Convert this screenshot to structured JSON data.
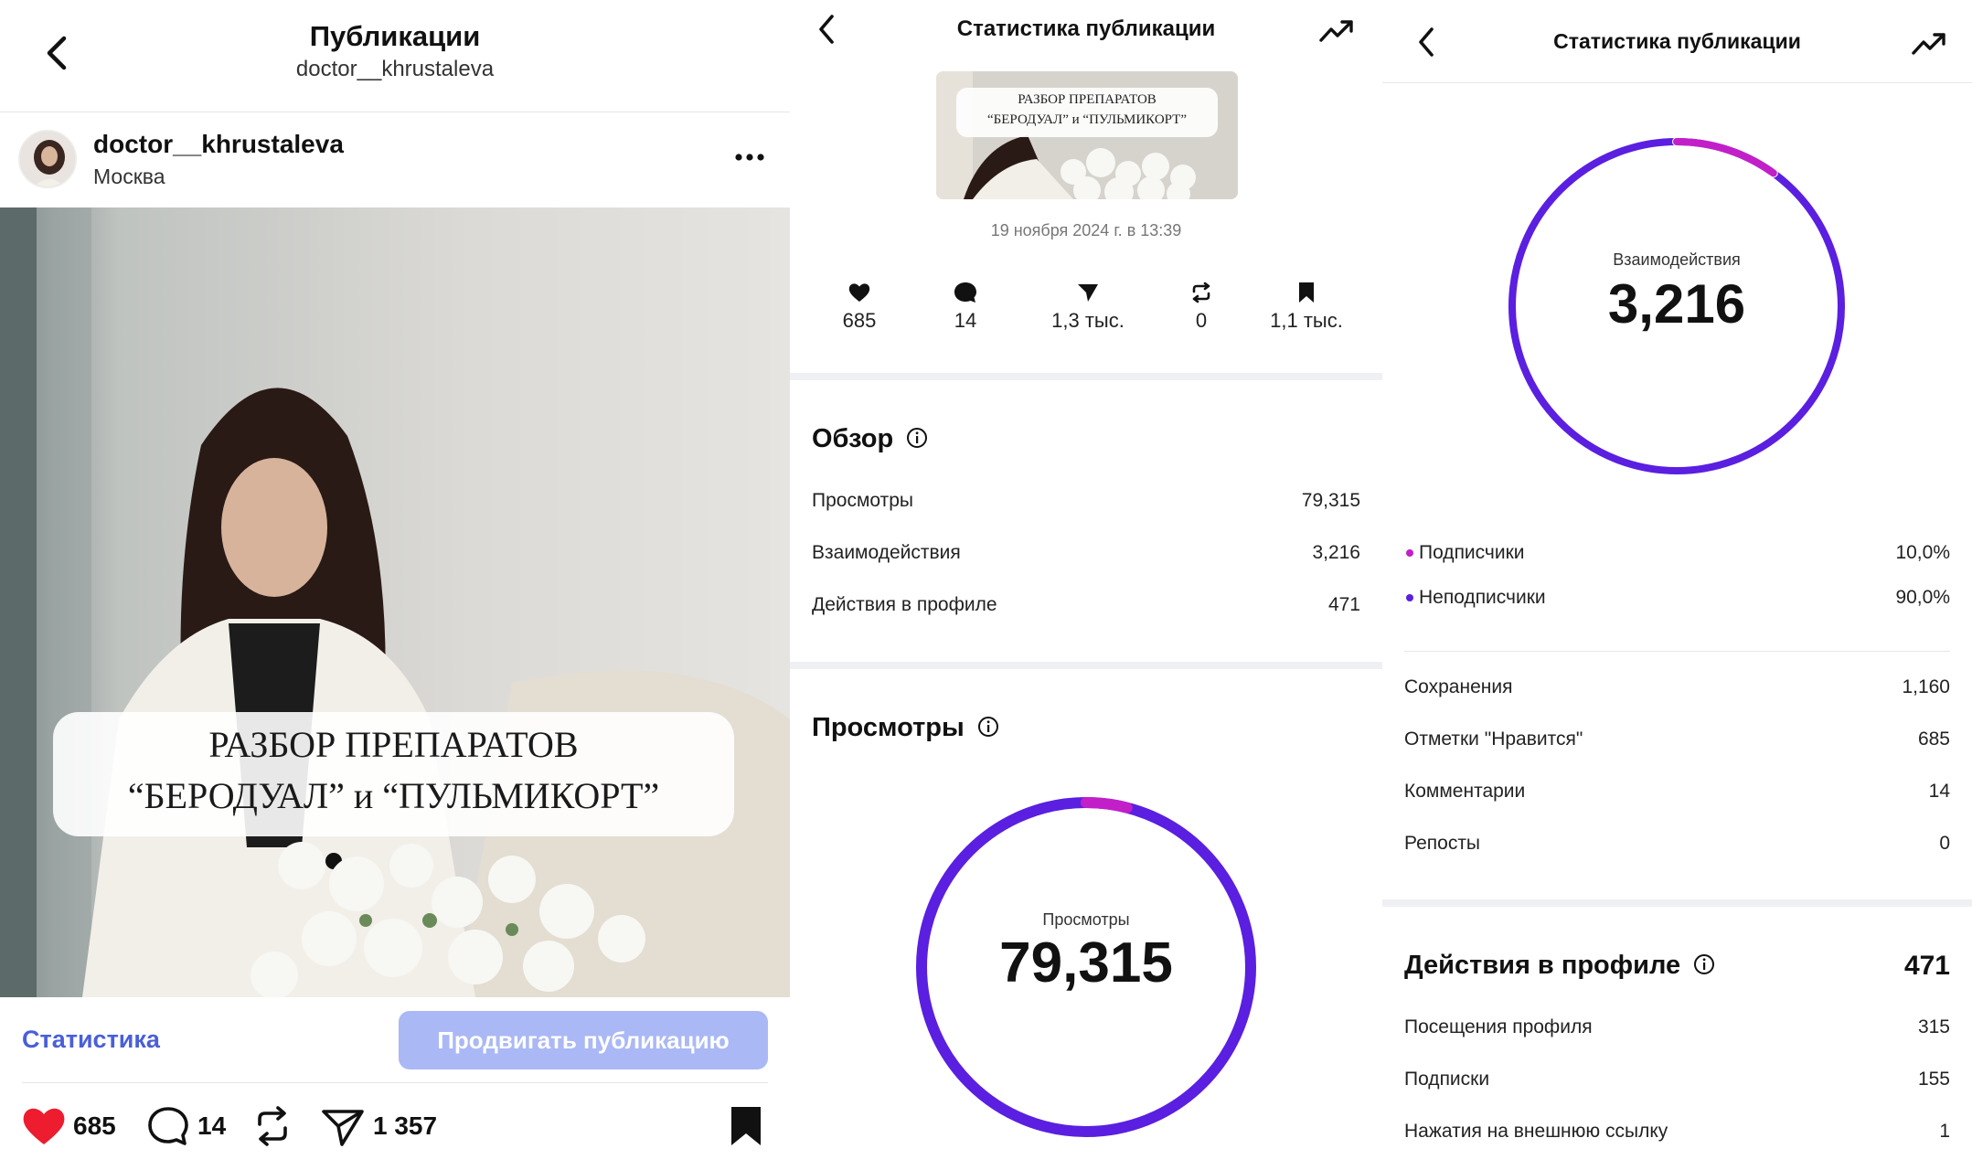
{
  "panel1": {
    "title": "Публикации",
    "subtitle": "doctor__khrustaleva",
    "author": {
      "username": "doctor__khrustaleva",
      "location": "Москва"
    },
    "more_icon": "more-horizontal-icon",
    "post_banner": {
      "line1": "РАЗБОР ПРЕПАРАТОВ",
      "line2": "“БЕРОДУАЛ” и “ПУЛЬМИКОРТ”"
    },
    "stats_link": "Статистика",
    "promote_button": "Продвигать публикацию",
    "actions": {
      "likes": "685",
      "comments": "14",
      "shares": "1 357"
    },
    "colors": {
      "accent": "#4a5fd9",
      "promote": "#aab8f5",
      "like": "#ed1c2e"
    }
  },
  "panel2": {
    "title": "Статистика публикации",
    "thumb_banner": {
      "line1": "РАЗБОР ПРЕПАРАТОВ",
      "line2": "“БЕРОДУАЛ” и “ПУЛЬМИКОРТ”"
    },
    "date": "19 ноября 2024 г. в 13:39",
    "metrics": [
      {
        "icon": "heart-icon",
        "value": "685"
      },
      {
        "icon": "comment-icon",
        "value": "14"
      },
      {
        "icon": "send-icon",
        "value": "1,3 тыс."
      },
      {
        "icon": "repost-icon",
        "value": "0"
      },
      {
        "icon": "bookmark-icon",
        "value": "1,1 тыс."
      }
    ],
    "overview": {
      "title": "Обзор",
      "rows": [
        {
          "label": "Просмотры",
          "value": "79,315"
        },
        {
          "label": "Взаимодействия",
          "value": "3,216"
        },
        {
          "label": "Действия в профиле",
          "value": "471"
        }
      ]
    },
    "views": {
      "title": "Просмотры",
      "ring_label": "Просмотры",
      "ring_value": "79,315",
      "followers_share": 0.04
    }
  },
  "panel3": {
    "title": "Статистика публикации",
    "ring_label": "Взаимодействия",
    "ring_value": "3,216",
    "legend": [
      {
        "label": "Подписчики",
        "value": "10,0%",
        "color": "#c21fc9"
      },
      {
        "label": "Неподписчики",
        "value": "90,0%",
        "color": "#5a1fe0"
      }
    ],
    "interaction_rows": [
      {
        "label": "Сохранения",
        "value": "1,160"
      },
      {
        "label": "Отметки \"Нравится\"",
        "value": "685"
      },
      {
        "label": "Комментарии",
        "value": "14"
      },
      {
        "label": "Репосты",
        "value": "0"
      }
    ],
    "profile_actions": {
      "title": "Действия в профиле",
      "total": "471",
      "rows": [
        {
          "label": "Посещения профиля",
          "value": "315"
        },
        {
          "label": "Подписки",
          "value": "155"
        },
        {
          "label": "Нажатия на внешнюю ссылку",
          "value": "1"
        }
      ]
    }
  }
}
